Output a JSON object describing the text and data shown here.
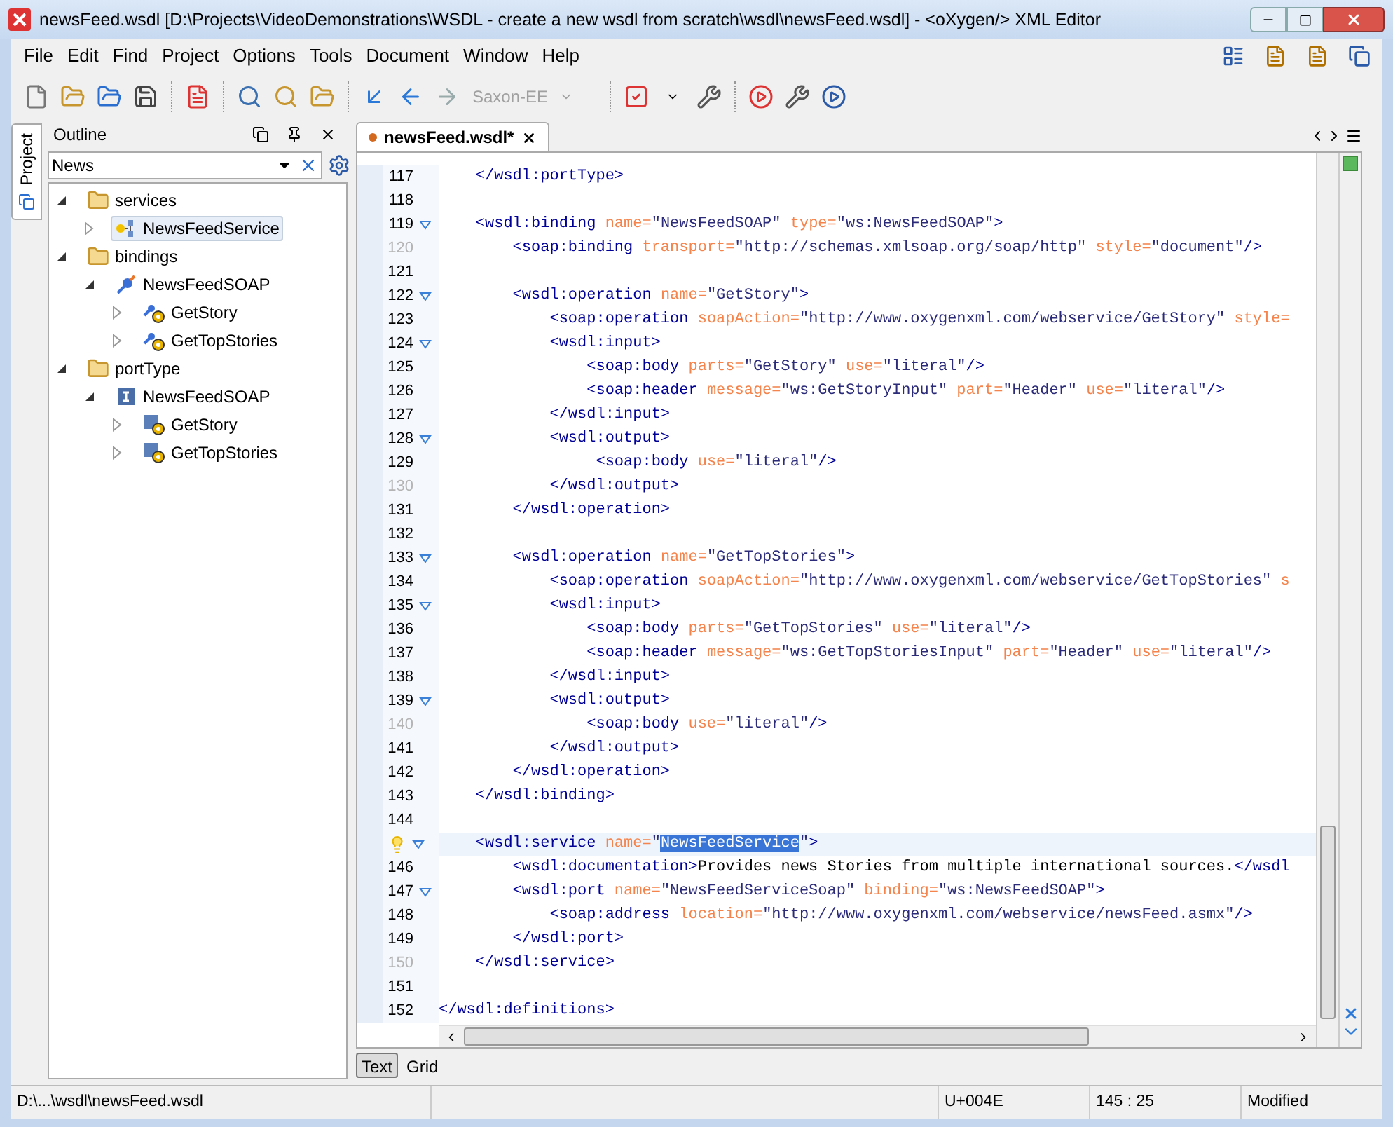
{
  "window": {
    "title": "newsFeed.wsdl [D:\\Projects\\VideoDemonstrations\\WSDL - create a new wsdl from scratch\\wsdl\\newsFeed.wsdl] - <oXygen/> XML Editor"
  },
  "menu": [
    "File",
    "Edit",
    "Find",
    "Project",
    "Options",
    "Tools",
    "Document",
    "Window",
    "Help"
  ],
  "toolbar": {
    "scenario": {
      "label": "Saxon-EE",
      "disabled": true
    }
  },
  "side_tab": {
    "label": "Project"
  },
  "outline": {
    "title": "Outline",
    "filter": {
      "value": "News"
    },
    "tree": [
      {
        "label": "services",
        "kind": "folder",
        "expanded": true,
        "selected": false,
        "children": [
          {
            "label": "NewsFeedService",
            "kind": "service",
            "expanded": false,
            "selected": true
          }
        ]
      },
      {
        "label": "bindings",
        "kind": "folder",
        "expanded": true,
        "selected": false,
        "children": [
          {
            "label": "NewsFeedSOAP",
            "kind": "binding",
            "expanded": true,
            "selected": false,
            "children": [
              {
                "label": "GetStory",
                "kind": "binding-operation",
                "expanded": false,
                "selected": false
              },
              {
                "label": "GetTopStories",
                "kind": "binding-operation",
                "expanded": false,
                "selected": false
              }
            ]
          }
        ]
      },
      {
        "label": "portType",
        "kind": "folder",
        "expanded": true,
        "selected": false,
        "children": [
          {
            "label": "NewsFeedSOAP",
            "kind": "porttype",
            "expanded": true,
            "selected": false,
            "children": [
              {
                "label": "GetStory",
                "kind": "operation",
                "expanded": false,
                "selected": false
              },
              {
                "label": "GetTopStories",
                "kind": "operation",
                "expanded": false,
                "selected": false
              }
            ]
          }
        ]
      }
    ]
  },
  "editor": {
    "tabs": [
      {
        "label": "newsFeed.wsdl*",
        "selected": true,
        "modified": true
      }
    ],
    "lines": [
      {
        "n": "117",
        "muted": false,
        "fold": false,
        "current": false,
        "hint": false,
        "tokens": [
          {
            "kind": "tag",
            "text": "    </wsdl:portType>"
          }
        ]
      },
      {
        "n": "118",
        "muted": false,
        "fold": false,
        "current": false,
        "hint": false
      },
      {
        "n": "119",
        "muted": false,
        "fold": true,
        "current": false,
        "hint": false,
        "tokens": [
          {
            "kind": "tag",
            "text": "    <wsdl:binding "
          },
          {
            "kind": "attr",
            "text": "name="
          },
          {
            "kind": "value",
            "text": "\"NewsFeedSOAP\" "
          },
          {
            "kind": "attr",
            "text": "type="
          },
          {
            "kind": "value",
            "text": "\"ws:NewsFeedSOAP\""
          },
          {
            "kind": "tag",
            "text": ">"
          }
        ]
      },
      {
        "n": "120",
        "muted": true,
        "fold": false,
        "current": false,
        "hint": false,
        "tokens": [
          {
            "kind": "tag",
            "text": "        <soap:binding "
          },
          {
            "kind": "attr",
            "text": "transport="
          },
          {
            "kind": "value",
            "text": "\"http://schemas.xmlsoap.org/soap/http\" "
          },
          {
            "kind": "attr",
            "text": "style="
          },
          {
            "kind": "value",
            "text": "\"document\""
          },
          {
            "kind": "tag",
            "text": "/>"
          }
        ]
      },
      {
        "n": "121",
        "muted": false,
        "fold": false,
        "current": false,
        "hint": false
      },
      {
        "n": "122",
        "muted": false,
        "fold": true,
        "current": false,
        "hint": false,
        "tokens": [
          {
            "kind": "tag",
            "text": "        <wsdl:operation "
          },
          {
            "kind": "attr",
            "text": "name="
          },
          {
            "kind": "value",
            "text": "\"GetStory\""
          },
          {
            "kind": "tag",
            "text": ">"
          }
        ]
      },
      {
        "n": "123",
        "muted": false,
        "fold": false,
        "current": false,
        "hint": false,
        "tokens": [
          {
            "kind": "tag",
            "text": "            <soap:operation "
          },
          {
            "kind": "attr",
            "text": "soapAction="
          },
          {
            "kind": "value",
            "text": "\"http://www.oxygenxml.com/webservice/GetStory\" "
          },
          {
            "kind": "attr",
            "text": "style="
          }
        ]
      },
      {
        "n": "124",
        "muted": false,
        "fold": true,
        "current": false,
        "hint": false,
        "tokens": [
          {
            "kind": "tag",
            "text": "            <wsdl:input>"
          }
        ]
      },
      {
        "n": "125",
        "muted": false,
        "fold": false,
        "current": false,
        "hint": false,
        "tokens": [
          {
            "kind": "tag",
            "text": "                <soap:body "
          },
          {
            "kind": "attr",
            "text": "parts="
          },
          {
            "kind": "value",
            "text": "\"GetStory\" "
          },
          {
            "kind": "attr",
            "text": "use="
          },
          {
            "kind": "value",
            "text": "\"literal\""
          },
          {
            "kind": "tag",
            "text": "/>"
          }
        ]
      },
      {
        "n": "126",
        "muted": false,
        "fold": false,
        "current": false,
        "hint": false,
        "tokens": [
          {
            "kind": "tag",
            "text": "                <soap:header "
          },
          {
            "kind": "attr",
            "text": "message="
          },
          {
            "kind": "value",
            "text": "\"ws:GetStoryInput\" "
          },
          {
            "kind": "attr",
            "text": "part="
          },
          {
            "kind": "value",
            "text": "\"Header\" "
          },
          {
            "kind": "attr",
            "text": "use="
          },
          {
            "kind": "value",
            "text": "\"literal\""
          },
          {
            "kind": "tag",
            "text": "/>"
          }
        ]
      },
      {
        "n": "127",
        "muted": false,
        "fold": false,
        "current": false,
        "hint": false,
        "tokens": [
          {
            "kind": "tag",
            "text": "            </wsdl:input>"
          }
        ]
      },
      {
        "n": "128",
        "muted": false,
        "fold": true,
        "current": false,
        "hint": false,
        "tokens": [
          {
            "kind": "tag",
            "text": "            <wsdl:output>"
          }
        ]
      },
      {
        "n": "129",
        "muted": false,
        "fold": false,
        "current": false,
        "hint": false,
        "tokens": [
          {
            "kind": "tag",
            "text": "                 <soap:body "
          },
          {
            "kind": "attr",
            "text": "use="
          },
          {
            "kind": "value",
            "text": "\"literal\""
          },
          {
            "kind": "tag",
            "text": "/>"
          }
        ]
      },
      {
        "n": "130",
        "muted": true,
        "fold": false,
        "current": false,
        "hint": false,
        "tokens": [
          {
            "kind": "tag",
            "text": "            </wsdl:output>"
          }
        ]
      },
      {
        "n": "131",
        "muted": false,
        "fold": false,
        "current": false,
        "hint": false,
        "tokens": [
          {
            "kind": "tag",
            "text": "        </wsdl:operation>"
          }
        ]
      },
      {
        "n": "132",
        "muted": false,
        "fold": false,
        "current": false,
        "hint": false
      },
      {
        "n": "133",
        "muted": false,
        "fold": true,
        "current": false,
        "hint": false,
        "tokens": [
          {
            "kind": "tag",
            "text": "        <wsdl:operation "
          },
          {
            "kind": "attr",
            "text": "name="
          },
          {
            "kind": "value",
            "text": "\"GetTopStories\""
          },
          {
            "kind": "tag",
            "text": ">"
          }
        ]
      },
      {
        "n": "134",
        "muted": false,
        "fold": false,
        "current": false,
        "hint": false,
        "tokens": [
          {
            "kind": "tag",
            "text": "            <soap:operation "
          },
          {
            "kind": "attr",
            "text": "soapAction="
          },
          {
            "kind": "value",
            "text": "\"http://www.oxygenxml.com/webservice/GetTopStories\" "
          },
          {
            "kind": "attr",
            "text": "s"
          }
        ]
      },
      {
        "n": "135",
        "muted": false,
        "fold": true,
        "current": false,
        "hint": false,
        "tokens": [
          {
            "kind": "tag",
            "text": "            <wsdl:input>"
          }
        ]
      },
      {
        "n": "136",
        "muted": false,
        "fold": false,
        "current": false,
        "hint": false,
        "tokens": [
          {
            "kind": "tag",
            "text": "                <soap:body "
          },
          {
            "kind": "attr",
            "text": "parts="
          },
          {
            "kind": "value",
            "text": "\"GetTopStories\" "
          },
          {
            "kind": "attr",
            "text": "use="
          },
          {
            "kind": "value",
            "text": "\"literal\""
          },
          {
            "kind": "tag",
            "text": "/>"
          }
        ]
      },
      {
        "n": "137",
        "muted": false,
        "fold": false,
        "current": false,
        "hint": false,
        "tokens": [
          {
            "kind": "tag",
            "text": "                <soap:header "
          },
          {
            "kind": "attr",
            "text": "message="
          },
          {
            "kind": "value",
            "text": "\"ws:GetTopStoriesInput\" "
          },
          {
            "kind": "attr",
            "text": "part="
          },
          {
            "kind": "value",
            "text": "\"Header\" "
          },
          {
            "kind": "attr",
            "text": "use="
          },
          {
            "kind": "value",
            "text": "\"literal\""
          },
          {
            "kind": "tag",
            "text": "/>"
          }
        ]
      },
      {
        "n": "138",
        "muted": false,
        "fold": false,
        "current": false,
        "hint": false,
        "tokens": [
          {
            "kind": "tag",
            "text": "            </wsdl:input>"
          }
        ]
      },
      {
        "n": "139",
        "muted": false,
        "fold": true,
        "current": false,
        "hint": false,
        "tokens": [
          {
            "kind": "tag",
            "text": "            <wsdl:output>"
          }
        ]
      },
      {
        "n": "140",
        "muted": true,
        "fold": false,
        "current": false,
        "hint": false,
        "tokens": [
          {
            "kind": "tag",
            "text": "                <soap:body "
          },
          {
            "kind": "attr",
            "text": "use="
          },
          {
            "kind": "value",
            "text": "\"literal\""
          },
          {
            "kind": "tag",
            "text": "/>"
          }
        ]
      },
      {
        "n": "141",
        "muted": false,
        "fold": false,
        "current": false,
        "hint": false,
        "tokens": [
          {
            "kind": "tag",
            "text": "            </wsdl:output>"
          }
        ]
      },
      {
        "n": "142",
        "muted": false,
        "fold": false,
        "current": false,
        "hint": false,
        "tokens": [
          {
            "kind": "tag",
            "text": "        </wsdl:operation>"
          }
        ]
      },
      {
        "n": "143",
        "muted": false,
        "fold": false,
        "current": false,
        "hint": false,
        "tokens": [
          {
            "kind": "tag",
            "text": "    </wsdl:binding>"
          }
        ]
      },
      {
        "n": "144",
        "muted": false,
        "fold": false,
        "current": false,
        "hint": false
      },
      {
        "fold": true,
        "current": true,
        "hint": true,
        "tokens": [
          {
            "kind": "tag",
            "text": "    <wsdl:service "
          },
          {
            "kind": "attr",
            "text": "name="
          },
          {
            "kind": "value",
            "text": "\""
          },
          {
            "kind": "selection",
            "text": "NewsFeedService"
          },
          {
            "kind": "value",
            "text": "\""
          },
          {
            "kind": "tag",
            "text": ">"
          }
        ]
      },
      {
        "n": "146",
        "muted": false,
        "fold": false,
        "current": false,
        "hint": false,
        "tokens": [
          {
            "kind": "tag",
            "text": "        <wsdl:documentation>"
          },
          {
            "kind": "text",
            "text": "Provides news Stories from multiple international sources."
          },
          {
            "kind": "tag",
            "text": "</wsdl"
          }
        ]
      },
      {
        "n": "147",
        "muted": false,
        "fold": true,
        "current": false,
        "hint": false,
        "tokens": [
          {
            "kind": "tag",
            "text": "        <wsdl:port "
          },
          {
            "kind": "attr",
            "text": "name="
          },
          {
            "kind": "value",
            "text": "\"NewsFeedServiceSoap\" "
          },
          {
            "kind": "attr",
            "text": "binding="
          },
          {
            "kind": "value",
            "text": "\"ws:NewsFeedSOAP\""
          },
          {
            "kind": "tag",
            "text": ">"
          }
        ]
      },
      {
        "n": "148",
        "muted": false,
        "fold": false,
        "current": false,
        "hint": false,
        "tokens": [
          {
            "kind": "tag",
            "text": "            <soap:address "
          },
          {
            "kind": "attr",
            "text": "location="
          },
          {
            "kind": "value",
            "text": "\"http://www.oxygenxml.com/webservice/newsFeed.asmx\""
          },
          {
            "kind": "tag",
            "text": "/>"
          }
        ]
      },
      {
        "n": "149",
        "muted": false,
        "fold": false,
        "current": false,
        "hint": false,
        "tokens": [
          {
            "kind": "tag",
            "text": "        </wsdl:port>"
          }
        ]
      },
      {
        "n": "150",
        "muted": true,
        "fold": false,
        "current": false,
        "hint": false,
        "tokens": [
          {
            "kind": "tag",
            "text": "    </wsdl:service>"
          }
        ]
      },
      {
        "n": "151",
        "muted": false,
        "fold": false,
        "current": false,
        "hint": false
      },
      {
        "n": "152",
        "muted": false,
        "fold": false,
        "current": false,
        "hint": false,
        "tokens": [
          {
            "kind": "tag",
            "text": "</wsdl:definitions>"
          }
        ]
      }
    ],
    "mode_tabs": [
      {
        "label": "Text",
        "selected": true
      },
      {
        "label": "Grid",
        "selected": false
      }
    ]
  },
  "status_bar": {
    "path": "D:\\...\\wsdl\\newsFeed.wsdl",
    "character": "U+004E",
    "position": "145 : 25",
    "state": "Modified"
  }
}
